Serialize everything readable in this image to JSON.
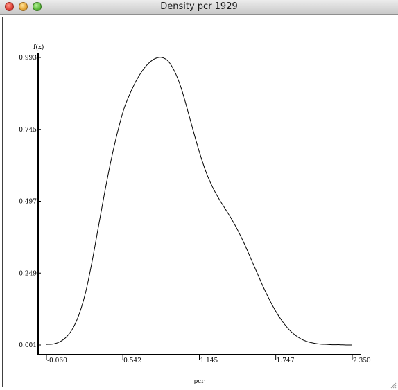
{
  "window": {
    "title": "Density pcr 1929"
  },
  "chart_data": {
    "type": "line",
    "title": "",
    "xlabel": "pcr",
    "ylabel": "f(x)",
    "xlim": [
      -0.06,
      2.35
    ],
    "ylim": [
      0.001,
      0.993
    ],
    "x_ticks": [
      "-0.060",
      "0.542",
      "1.145",
      "1.747",
      "2.350"
    ],
    "y_ticks": [
      "0.001",
      "0.249",
      "0.497",
      "0.745",
      "0.993"
    ],
    "grid": false,
    "series": [
      {
        "x": [
          -0.06,
          0.0,
          0.05,
          0.1,
          0.15,
          0.2,
          0.25,
          0.3,
          0.35,
          0.4,
          0.45,
          0.5,
          0.55,
          0.6,
          0.65,
          0.7,
          0.75,
          0.8,
          0.85,
          0.9,
          0.95,
          1.0,
          1.05,
          1.1,
          1.15,
          1.2,
          1.25,
          1.3,
          1.35,
          1.4,
          1.45,
          1.5,
          1.55,
          1.6,
          1.65,
          1.7,
          1.75,
          1.8,
          1.85,
          1.9,
          1.95,
          2.0,
          2.05,
          2.1,
          2.15,
          2.2,
          2.25,
          2.3,
          2.35
        ],
        "y": [
          0.003,
          0.005,
          0.013,
          0.03,
          0.06,
          0.11,
          0.185,
          0.29,
          0.41,
          0.53,
          0.64,
          0.735,
          0.815,
          0.87,
          0.915,
          0.95,
          0.975,
          0.99,
          0.993,
          0.98,
          0.945,
          0.89,
          0.815,
          0.735,
          0.66,
          0.595,
          0.545,
          0.505,
          0.47,
          0.435,
          0.395,
          0.35,
          0.3,
          0.25,
          0.2,
          0.155,
          0.115,
          0.082,
          0.055,
          0.035,
          0.021,
          0.012,
          0.007,
          0.004,
          0.003,
          0.002,
          0.002,
          0.001,
          0.001
        ]
      }
    ]
  }
}
